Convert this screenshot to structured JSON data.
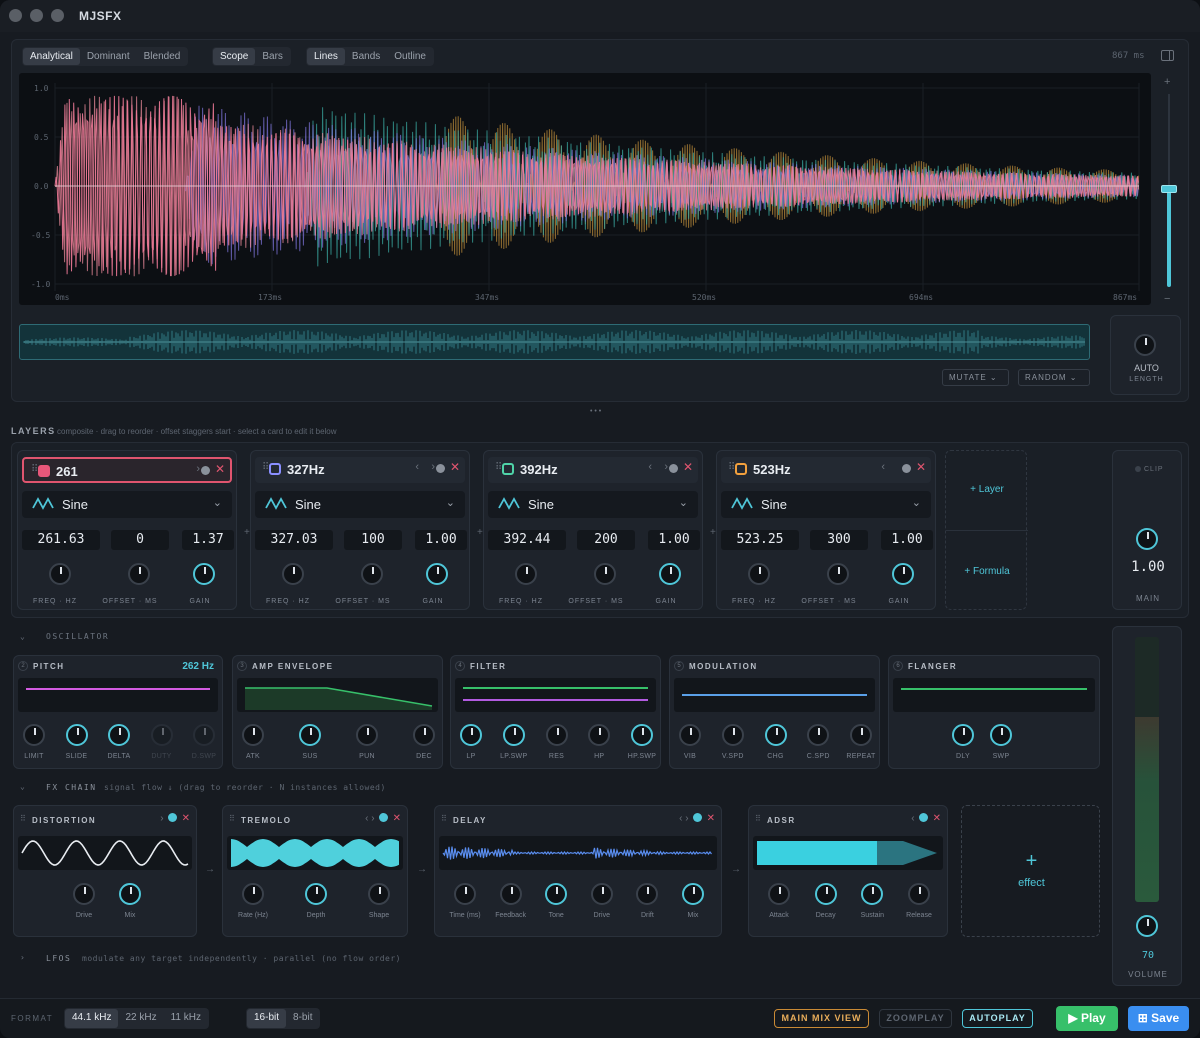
{
  "app": {
    "title": "MJSFX"
  },
  "scope": {
    "view_modes": [
      "Analytical",
      "Dominant",
      "Blended"
    ],
    "display_modes": [
      "Scope",
      "Bars"
    ],
    "line_modes": [
      "Lines",
      "Bands",
      "Outline"
    ],
    "duration": "867 ms",
    "y_ticks": [
      "1.0",
      "0.5",
      "0.0",
      "-0.5",
      "-1.0"
    ],
    "x_ticks": [
      "0ms",
      "173ms",
      "347ms",
      "520ms",
      "694ms",
      "867ms"
    ],
    "zoom_plus": "+",
    "zoom_minus": "−",
    "mutate": "MUTATE",
    "random": "RANDOM",
    "auto_length": "AUTO",
    "auto_length2": "LENGTH",
    "more": "• • •"
  },
  "layers": {
    "title": "LAYERS",
    "hint": "composite · drag to reorder · offset staggers start · select a card to edit it below",
    "cards": [
      {
        "name": "261",
        "color": "#e8577a",
        "wave": "Sine",
        "freq": "261.63",
        "offset": "0",
        "gain": "1.37",
        "dot": true
      },
      {
        "name": "327Hz",
        "color": "#8a8fff",
        "wave": "Sine",
        "freq": "327.03",
        "offset": "100",
        "gain": "1.00",
        "dot": false
      },
      {
        "name": "392Hz",
        "color": "#4fd3a8",
        "wave": "Sine",
        "freq": "392.44",
        "offset": "200",
        "gain": "1.00",
        "dot": false
      },
      {
        "name": "523Hz",
        "color": "#f2a03d",
        "wave": "Sine",
        "freq": "523.25",
        "offset": "300",
        "gain": "1.00",
        "dot": true
      }
    ],
    "knob_labels": [
      "FREQ · HZ",
      "OFFSET · MS",
      "GAIN"
    ],
    "add_layer": "+ Layer",
    "add_formula": "+ Formula",
    "clip": "CLIP",
    "main_value": "1.00",
    "main_label": "MAIN"
  },
  "oscillator": {
    "title": "OSCILLATOR",
    "modules": [
      {
        "idx": "2",
        "name": "PITCH",
        "value": "262 Hz",
        "knobs": [
          "LIMIT",
          "SLIDE",
          "DELTA",
          "DUTY",
          "D.SWP"
        ]
      },
      {
        "idx": "3",
        "name": "AMP ENVELOPE",
        "knobs": [
          "ATK",
          "SUS",
          "PUN",
          "DEC"
        ]
      },
      {
        "idx": "4",
        "name": "FILTER",
        "knobs": [
          "LP",
          "LP.SWP",
          "RES",
          "HP",
          "HP.SWP"
        ]
      },
      {
        "idx": "5",
        "name": "MODULATION",
        "knobs": [
          "VIB",
          "V.SPD",
          "CHG",
          "C.SPD",
          "REPEAT"
        ]
      },
      {
        "idx": "6",
        "name": "FLANGER",
        "knobs": [
          "DLY",
          "SWP"
        ]
      }
    ]
  },
  "fx": {
    "title": "FX CHAIN",
    "hint": "signal flow ↓  (drag to reorder · N instances allowed)",
    "modules": [
      {
        "name": "DISTORTION",
        "knobs": [
          "Drive",
          "Mix"
        ]
      },
      {
        "name": "TREMOLO",
        "knobs": [
          "Rate (Hz)",
          "Depth",
          "Shape"
        ]
      },
      {
        "name": "DELAY",
        "knobs": [
          "Time (ms)",
          "Feedback",
          "Tone",
          "Drive",
          "Drift",
          "Mix"
        ]
      },
      {
        "name": "ADSR",
        "knobs": [
          "Attack",
          "Decay",
          "Sustain",
          "Release"
        ]
      }
    ],
    "add_plus": "+",
    "add_effect": "effect"
  },
  "lfos": {
    "title": "LFOS",
    "hint": "modulate any target independently · parallel (no flow order)"
  },
  "volume": {
    "value": "70",
    "label": "VOLUME",
    "level": 0.7
  },
  "footer": {
    "format": "FORMAT",
    "rates": [
      "44.1 kHz",
      "22 kHz",
      "11 kHz"
    ],
    "bits": [
      "16-bit",
      "8-bit"
    ],
    "main_mix": "MAIN MIX VIEW",
    "zoomplay": "ZOOMPLAY",
    "autoplay": "AUTOPLAY",
    "play": "▶ Play",
    "save": "⊞ Save"
  },
  "colors": {
    "accent": "#4fc6d8",
    "pink": "#e8577a",
    "green": "#37c06a",
    "blue": "#3a8ef0"
  }
}
